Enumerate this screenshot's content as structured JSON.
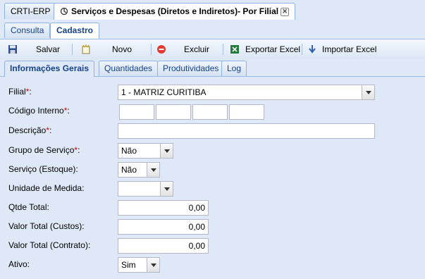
{
  "app_tabs": [
    {
      "label": "CRTI-ERP"
    },
    {
      "label": "Serviços e Despesas (Diretos e Indiretos)- Por Filial",
      "close": "✕"
    }
  ],
  "sub_tabs": [
    {
      "label": "Consulta"
    },
    {
      "label": "Cadastro"
    }
  ],
  "toolbar": {
    "save": "Salvar",
    "new": "Novo",
    "delete": "Excluir",
    "export": "Exportar Excel",
    "import": "Importar Excel"
  },
  "form_tabs": [
    {
      "label": "Informações Gerais"
    },
    {
      "label": "Quantidades"
    },
    {
      "label": "Produtividades"
    },
    {
      "label": "Log"
    }
  ],
  "form": {
    "filial": {
      "label": "Filial",
      "required": "*",
      "value": "1 - MATRIZ CURITIBA"
    },
    "codigo": {
      "label": "Código Interno",
      "required": "*",
      "parts": [
        "",
        "",
        "",
        ""
      ]
    },
    "descricao": {
      "label": "Descrição",
      "required": "*",
      "value": ""
    },
    "grupo": {
      "label": "Grupo de Serviço",
      "required": "*",
      "value": "Não"
    },
    "servico": {
      "label": "Serviço (Estoque):",
      "value": "Não"
    },
    "unidade": {
      "label": "Unidade de Medida:",
      "value": ""
    },
    "qtde": {
      "label": "Qtde Total:",
      "value": "0,00"
    },
    "custos": {
      "label": "Valor Total (Custos):",
      "value": "0,00"
    },
    "contrato": {
      "label": "Valor Total (Contrato):",
      "value": "0,00"
    },
    "ativo": {
      "label": "Ativo:",
      "value": "Sim"
    }
  },
  "colors": {
    "accent": "#15428b",
    "required": "#dd0000",
    "panel": "#dfe8f6"
  }
}
